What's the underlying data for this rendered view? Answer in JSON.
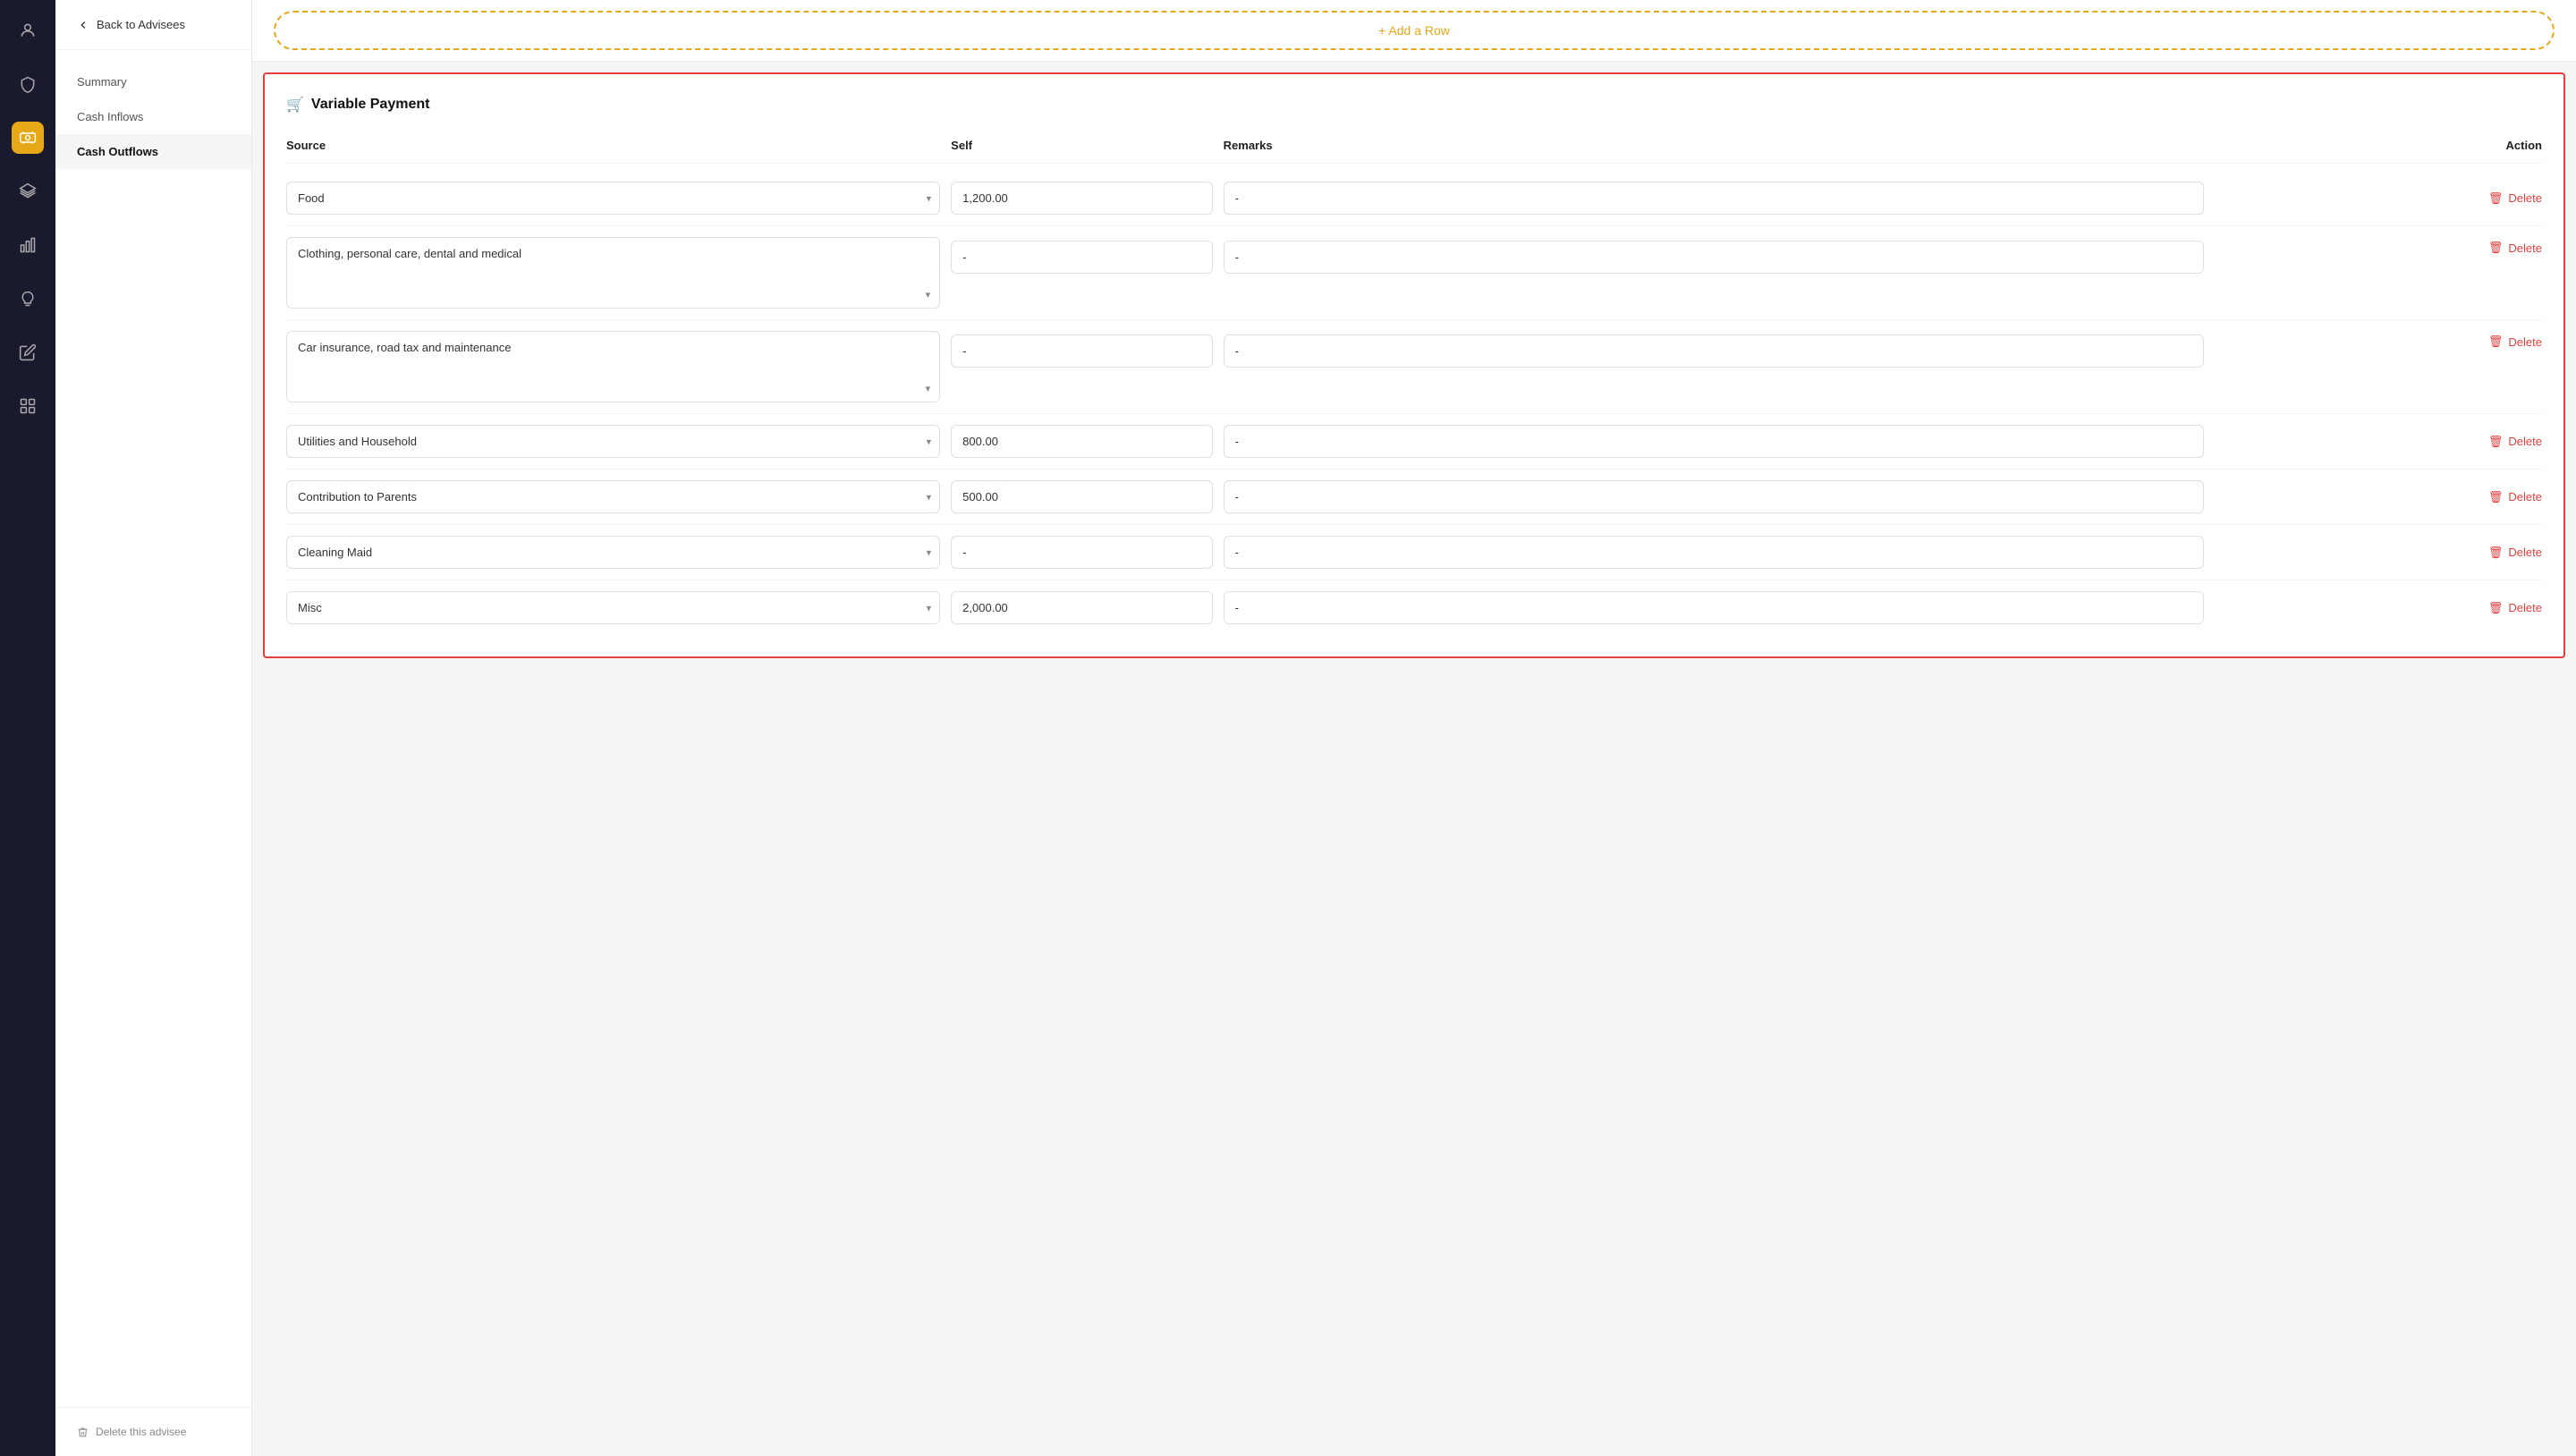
{
  "sidebar": {
    "icons": [
      {
        "name": "person-icon",
        "symbol": "👤",
        "active": false
      },
      {
        "name": "shield-icon",
        "symbol": "🛡",
        "active": false
      },
      {
        "name": "cash-icon",
        "symbol": "💵",
        "active": true
      },
      {
        "name": "layers-icon",
        "symbol": "⊞",
        "active": false
      },
      {
        "name": "chart-icon",
        "symbol": "📊",
        "active": false
      },
      {
        "name": "bulb-icon",
        "symbol": "💡",
        "active": false
      },
      {
        "name": "edit-icon",
        "symbol": "✏",
        "active": false
      },
      {
        "name": "box-icon",
        "symbol": "🗂",
        "active": false
      }
    ]
  },
  "nav": {
    "back_label": "Back to Advisees",
    "items": [
      {
        "id": "summary",
        "label": "Summary",
        "active": false
      },
      {
        "id": "cash-inflows",
        "label": "Cash Inflows",
        "active": false
      },
      {
        "id": "cash-outflows",
        "label": "Cash Outflows",
        "active": true
      }
    ],
    "delete_label": "Delete this advisee"
  },
  "add_row": {
    "label": "+ Add a Row"
  },
  "variable_payment": {
    "title": "Variable Payment",
    "columns": {
      "source": "Source",
      "self": "Self",
      "remarks": "Remarks",
      "action": "Action"
    },
    "rows": [
      {
        "id": 1,
        "source": "Food",
        "self_value": "1,200.00",
        "remarks": "-",
        "delete_label": "Delete"
      },
      {
        "id": 2,
        "source": "Clothing, personal care, dental and medical",
        "self_value": "-",
        "remarks": "-",
        "delete_label": "Delete",
        "multiline": true
      },
      {
        "id": 3,
        "source": "Car insurance, road tax and maintenance",
        "self_value": "-",
        "remarks": "-",
        "delete_label": "Delete",
        "multiline": true
      },
      {
        "id": 4,
        "source": "Utilities and Household",
        "self_value": "800.00",
        "remarks": "-",
        "delete_label": "Delete"
      },
      {
        "id": 5,
        "source": "Contribution to Parents",
        "self_value": "500.00",
        "remarks": "-",
        "delete_label": "Delete"
      },
      {
        "id": 6,
        "source": "Cleaning Maid",
        "self_value": "-",
        "remarks": "-",
        "delete_label": "Delete"
      },
      {
        "id": 7,
        "source": "Misc",
        "self_value": "2,000.00",
        "remarks": "-",
        "delete_label": "Delete"
      }
    ]
  }
}
